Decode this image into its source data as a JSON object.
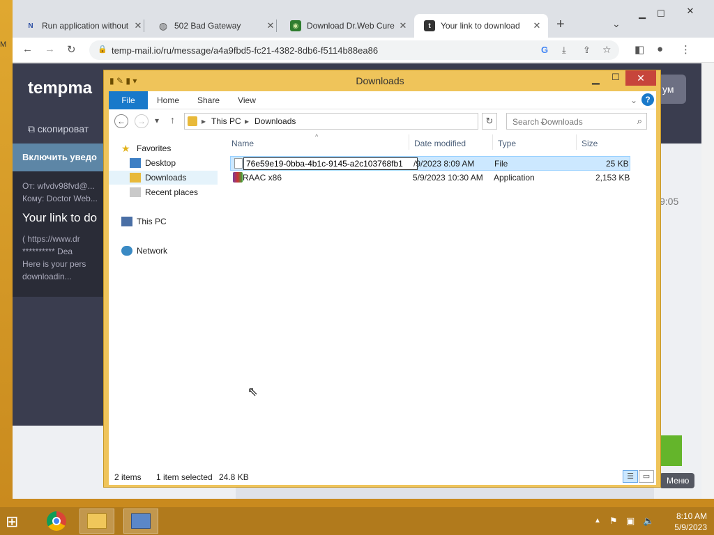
{
  "desktop": {
    "edge_text": "M"
  },
  "browser": {
    "tabs": [
      {
        "label": "Run application without",
        "icon": "notion-icon"
      },
      {
        "label": "502 Bad Gateway",
        "icon": "globe-icon"
      },
      {
        "label": "Download Dr.Web Cure",
        "icon": "drweb-icon"
      },
      {
        "label": "Your link to download",
        "icon": "tempmail-icon"
      }
    ],
    "url": "temp-mail.io/ru/message/a4a9fbd5-fc21-4382-8db6-f5114b88ea86"
  },
  "page": {
    "brand": "tempma",
    "copy_button": "скопироват",
    "right_button": "ум",
    "notify": "Включить уведо",
    "mail_from": "От: wfvdv98fvd@...",
    "mail_to": "Кому: Doctor Web...",
    "mail_subject": "Your link to do",
    "mail_line1": "( https://www.dr",
    "mail_line2": "********** Dea",
    "mail_line3": "Here is your pers",
    "mail_line4": "downloadin...",
    "time": "9:05",
    "menu_button": "Меню"
  },
  "explorer": {
    "title": "Downloads",
    "ribbon_tabs": [
      "File",
      "Home",
      "Share",
      "View"
    ],
    "breadcrumb": [
      "This PC",
      "Downloads"
    ],
    "search_placeholder": "Search Downloads",
    "nav": {
      "favorites": "Favorites",
      "desktop": "Desktop",
      "downloads": "Downloads",
      "recent": "Recent places",
      "this_pc": "This PC",
      "network": "Network"
    },
    "columns": {
      "name": "Name",
      "date": "Date modified",
      "type": "Type",
      "size": "Size"
    },
    "files": [
      {
        "name": "76e59e19-0bba-4b1c-9145-a2c103768fb1",
        "date": "5/9/2023 8:09 AM",
        "date_visible": "/9/2023 8:09 AM",
        "type": "File",
        "size": "25 KB"
      },
      {
        "name": "RAAC x86",
        "date": "5/9/2023 10:30 AM",
        "type": "Application",
        "size": "2,153 KB"
      }
    ],
    "status": {
      "items": "2 items",
      "selected": "1 item selected",
      "size": "24.8 KB"
    }
  },
  "taskbar": {
    "clock_time": "8:10 AM",
    "clock_date": "5/9/2023"
  },
  "colors": {
    "accent": "#1979ca",
    "selection": "#cce8ff",
    "window_frame": "#efc45a",
    "close_red": "#c7453b",
    "taskbar": "#b17a1c"
  }
}
